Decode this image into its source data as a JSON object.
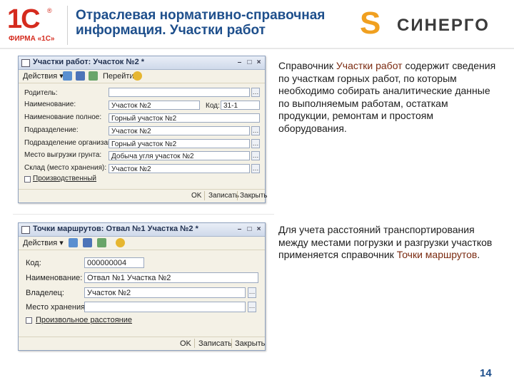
{
  "header": {
    "logo_1c": {
      "main": "1С",
      "reg": "®",
      "caption": "ФИРМА «1С»"
    },
    "title_line1": "Отраслевая нормативно-справочная",
    "title_line2": "информация. Участки работ",
    "logo_sinergo": {
      "symbol": "S",
      "text": "СИНЕРГО"
    }
  },
  "window1": {
    "title": "Участки работ: Участок №2 *",
    "menu_actions": "Действия ▾",
    "menu_goto": "Перейти ▾",
    "fields": [
      {
        "label": "Родитель:",
        "value": ""
      },
      {
        "label": "Наименование:",
        "value": "Участок №2"
      },
      {
        "label": "Наименование полное:",
        "value": "Горный участок №2"
      },
      {
        "label": "Подразделение:",
        "value": "Участок №2"
      },
      {
        "label": "Подразделение организации:",
        "value": "Горный участок №2"
      },
      {
        "label": "Место выгрузки грунта:",
        "value": "Добыча угля участок №2"
      },
      {
        "label": "Склад (место хранения):",
        "value": "Участок №2"
      }
    ],
    "code_label": "Код:",
    "code_value": "31-1",
    "checkbox_label": "Производственный",
    "btn_ok": "OK",
    "btn_save": "Записать",
    "btn_close": "Закрыть"
  },
  "window2": {
    "title": "Точки маршрутов: Отвал №1 Участка №2 *",
    "menu_actions": "Действия ▾",
    "fields": [
      {
        "label": "Код:",
        "value": "000000004"
      },
      {
        "label": "Наименование:",
        "value": "Отвал №1 Участка №2"
      },
      {
        "label": "Владелец:",
        "value": "Участок №2"
      },
      {
        "label": "Место хранения:",
        "value": ""
      }
    ],
    "checkbox_label": "Произвольное расстояние",
    "btn_ok": "OK",
    "btn_save": "Записать",
    "btn_close": "Закрыть"
  },
  "text1": {
    "before": "Справочник ",
    "highlight": "Участки работ",
    "after": " содержит сведения по участкам горных работ, по которым необходимо собирать аналитические данные по выполняемым работам, остаткам продукции, ремонтам и простоям оборудования."
  },
  "text2": {
    "before": "Для учета расстояний транспортирования между местами погрузки и разгрузки участков применяется справочник ",
    "highlight": "Точки маршрутов",
    "after": "."
  },
  "page_number": "14",
  "colors": {
    "title_blue": "#1e4f8c",
    "red_1c": "#d52b1e",
    "sinergo_orange": "#f0a020",
    "highlight": "#7a2a10"
  }
}
